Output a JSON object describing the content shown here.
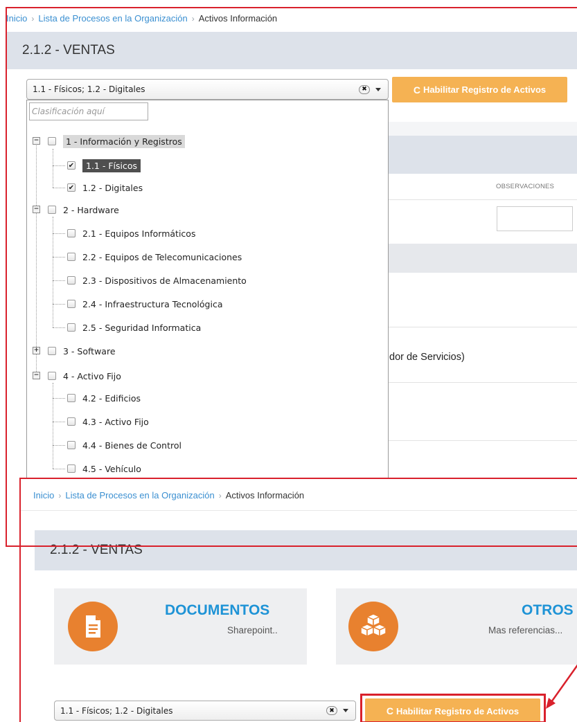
{
  "breadcrumb": {
    "home": "Inicio",
    "process_list": "Lista de Procesos en la Organización",
    "current": "Activos Información",
    "separator": "›"
  },
  "page_title": "2.1.2 - VENTAS",
  "select": {
    "value": "1.1 - Físicos; 1.2 - Digitales",
    "clear_symbol": "✖"
  },
  "enable_button": {
    "icon": "refresh-icon",
    "label": "Habilitar Registro de Activos"
  },
  "dropdown": {
    "search_placeholder": "Clasificación aquí",
    "tree": [
      {
        "label": "1 - Información y Registros",
        "level": 0,
        "expanded": true,
        "checked": false
      },
      {
        "label": "1.1 - Físicos",
        "level": 1,
        "checked": true
      },
      {
        "label": "1.2 - Digitales",
        "level": 1,
        "checked": true
      },
      {
        "label": "2 - Hardware",
        "level": 0,
        "expanded": true,
        "checked": false
      },
      {
        "label": "2.1 - Equipos Informáticos",
        "level": 1,
        "checked": false
      },
      {
        "label": "2.2 - Equipos de Telecomunicaciones",
        "level": 1,
        "checked": false
      },
      {
        "label": "2.3 - Dispositivos de Almacenamiento",
        "level": 1,
        "checked": false
      },
      {
        "label": "2.4 - Infraestructura Tecnológica",
        "level": 1,
        "checked": false
      },
      {
        "label": "2.5 - Seguridad Informatica",
        "level": 1,
        "checked": false
      },
      {
        "label": "3 - Software",
        "level": 0,
        "expanded": false,
        "checked": false
      },
      {
        "label": "4 - Activo Fijo",
        "level": 0,
        "expanded": true,
        "checked": false
      },
      {
        "label": "4.2 - Edificios",
        "level": 1,
        "checked": false
      },
      {
        "label": "4.3 - Activo Fijo",
        "level": 1,
        "checked": false
      },
      {
        "label": "4.4 - Bienes de Control",
        "level": 1,
        "checked": false
      },
      {
        "label": "4.5 - Vehículo",
        "level": 1,
        "checked": false
      }
    ]
  },
  "background": {
    "observaciones_header": "OBSERVACIONES",
    "partial_text": "dor de Servicios)"
  },
  "cards": [
    {
      "title": "DOCUMENTOS",
      "subtitle": "Sharepoint..",
      "icon": "document-icon"
    },
    {
      "title": "OTROS",
      "subtitle": "Mas referencias...",
      "icon": "boxes-icon"
    }
  ],
  "colors": {
    "accent_orange": "#e8812f",
    "button_orange": "#f5b253",
    "link_blue": "#3a8fd1",
    "title_blue": "#1e93d6",
    "annotation_red": "#d9212c",
    "band_gray": "#dde2ea"
  }
}
